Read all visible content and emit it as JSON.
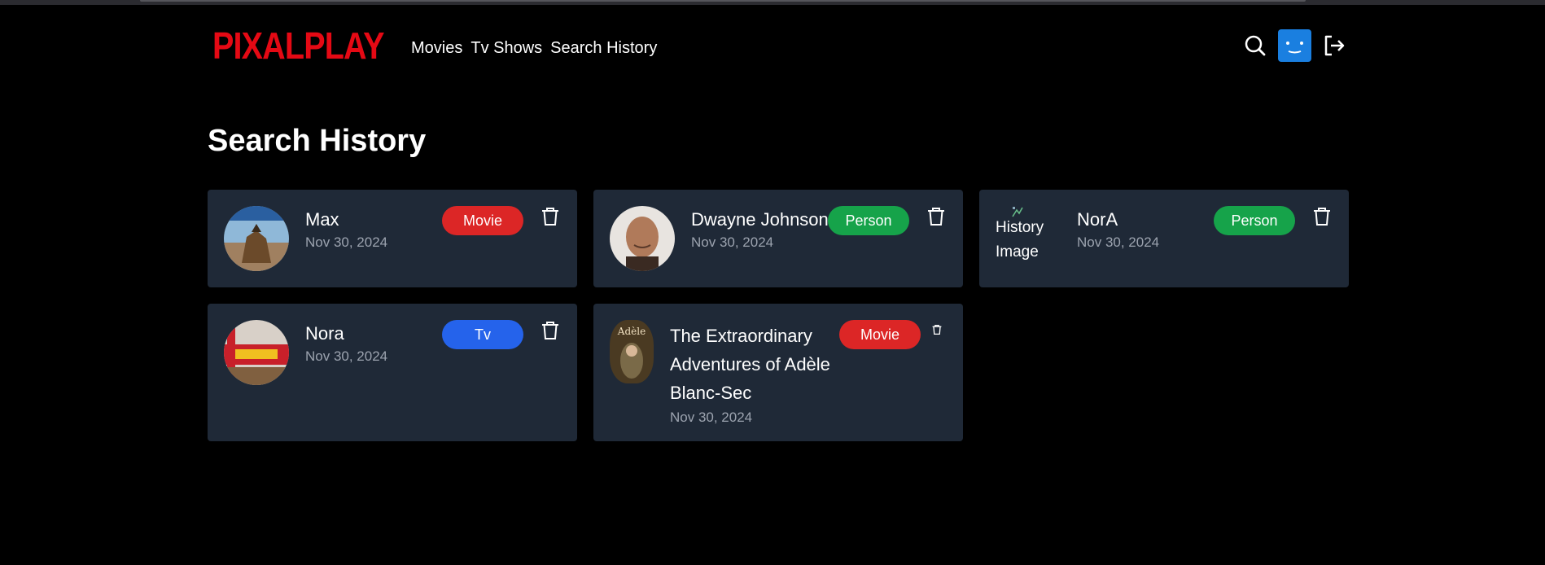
{
  "brand": {
    "logo_text": "PIXALPLAY",
    "logo_color": "#e50914"
  },
  "nav": {
    "items": [
      "Movies",
      "Tv Shows",
      "Search History"
    ]
  },
  "header_icons": [
    "search-icon",
    "avatar-icon",
    "logout-icon"
  ],
  "page": {
    "title": "Search History"
  },
  "colors": {
    "card_bg": "#1f2937",
    "movie": "#dc2626",
    "person": "#16a34a",
    "tv": "#2563eb",
    "avatar": "#1a7fe0"
  },
  "history": [
    {
      "title": "Max",
      "date": "Nov 30, 2024",
      "type": "Movie"
    },
    {
      "title": "Dwayne Johnson",
      "date": "Nov 30, 2024",
      "type": "Person"
    },
    {
      "title": "NorA",
      "date": "Nov 30, 2024",
      "type": "Person",
      "image_alt": "History Image"
    },
    {
      "title": "Nora",
      "date": "Nov 30, 2024",
      "type": "Tv"
    },
    {
      "title": "The Extraordinary Adventures of Adèle Blanc-Sec",
      "date": "Nov 30, 2024",
      "type": "Movie",
      "poster_text": "Adèle"
    }
  ]
}
